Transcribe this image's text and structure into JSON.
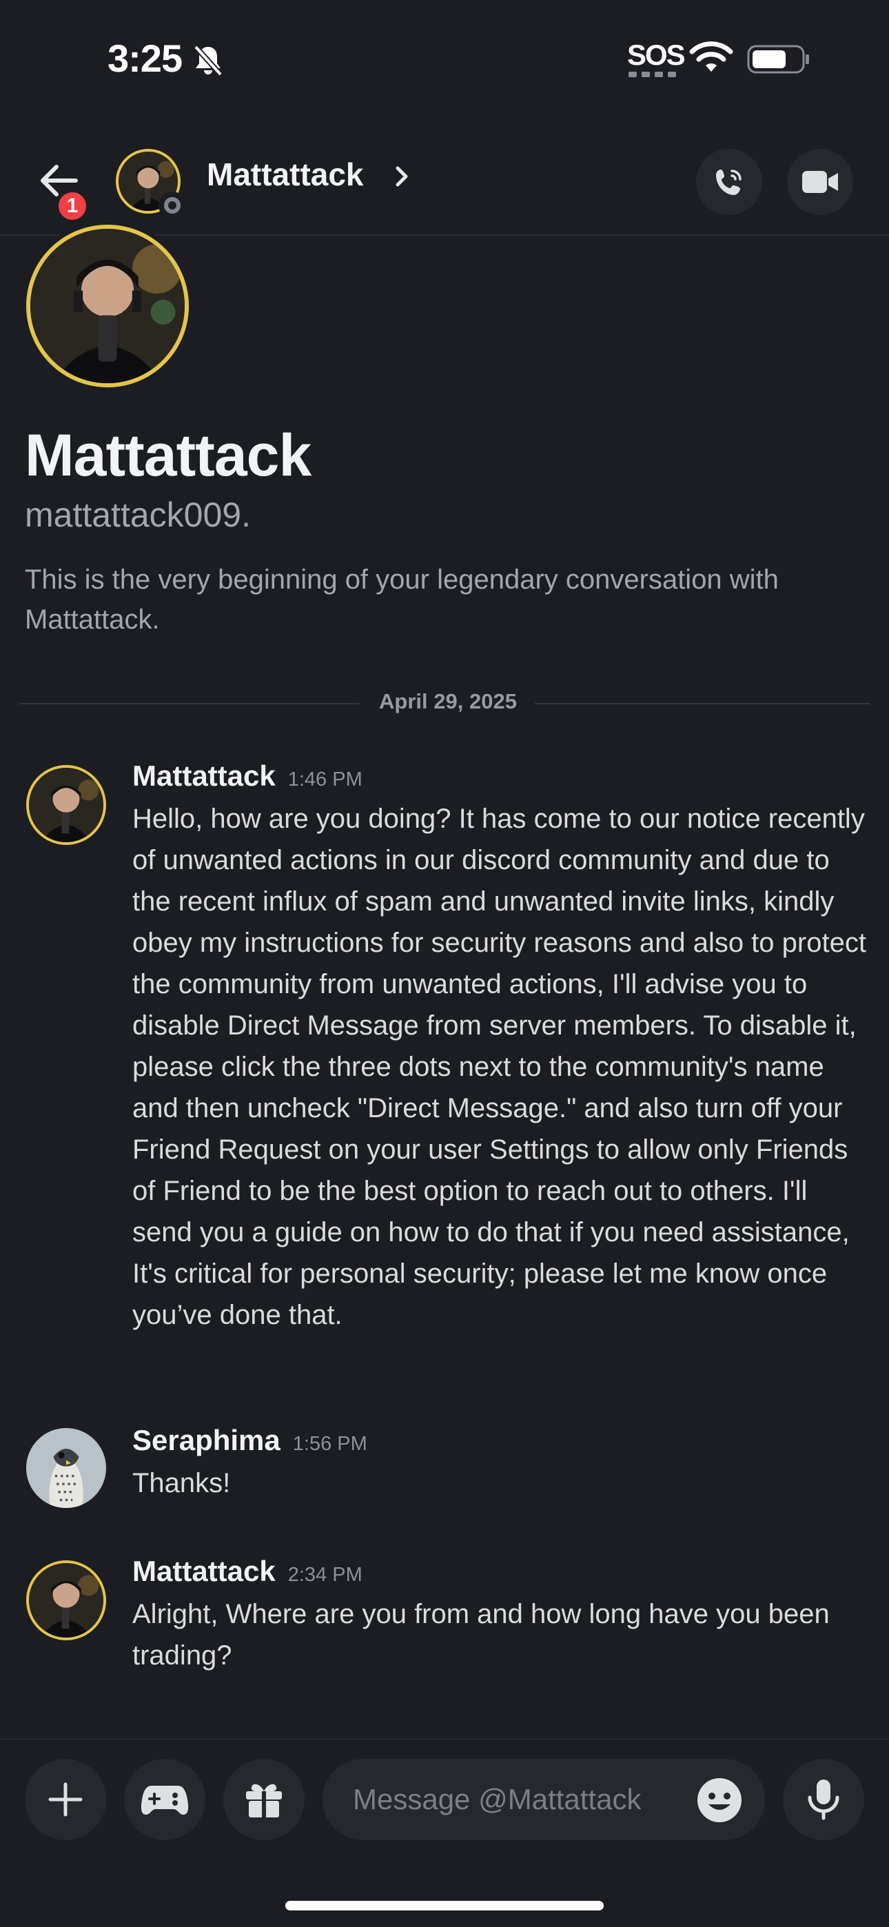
{
  "status_bar": {
    "time": "3:25",
    "sos": "SOS"
  },
  "header": {
    "unread_badge": "1",
    "name": "Mattattack"
  },
  "intro": {
    "name": "Mattattack",
    "handle": "mattattack009.",
    "description": "This is the very beginning of your legendary conversation with Mattattack."
  },
  "date_divider": "April 29, 2025",
  "messages": [
    {
      "author": "Mattattack",
      "time": "1:46 PM",
      "text": "Hello, how are you doing? It has come to our notice recently of unwanted actions in our discord community and due to the recent influx of spam and unwanted invite links, kindly obey my instructions for security reasons and also to protect the community from unwanted actions, I'll advise you to disable Direct Message from server members. To disable it, please click the three dots next to the community's name and then uncheck \"Direct Message.\" and also turn off your Friend Request on your user Settings to allow only Friends of Friend to be the best option to reach out to others. I'll send you a guide on how to do that if you need assistance, It's critical for personal security; please let me know once you’ve done that."
    },
    {
      "author": "Seraphima",
      "time": "1:56 PM",
      "text": "Thanks!"
    },
    {
      "author": "Mattattack",
      "time": "2:34 PM",
      "text": "Alright, Where are you from and how long have you been trading?"
    }
  ],
  "composer": {
    "placeholder": "Message @Mattattack"
  },
  "icons": {
    "status": [
      "bell-slash-icon",
      "sos-icon",
      "wifi-icon",
      "battery-icon"
    ],
    "header": [
      "back-arrow-icon",
      "chevron-right-icon",
      "phone-call-icon",
      "video-camera-icon"
    ],
    "composer": [
      "plus-icon",
      "gamepad-icon",
      "gift-icon",
      "emoji-icon",
      "microphone-icon"
    ]
  },
  "colors": {
    "background": "#1c1d22",
    "avatar_ring": "#e3c54a",
    "badge": "#f23f43",
    "button": "#26282e"
  }
}
